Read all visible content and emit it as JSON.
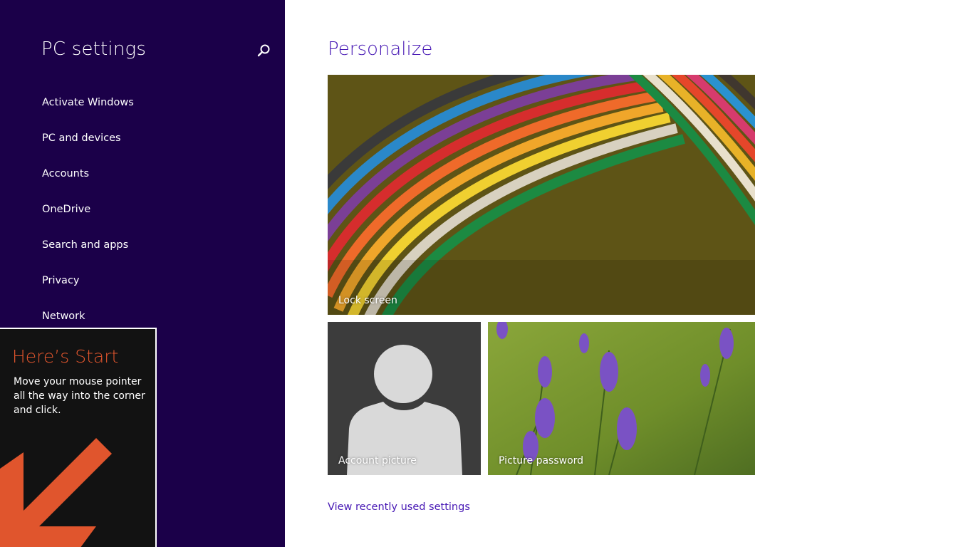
{
  "sidebar": {
    "title": "PC settings",
    "search_icon": "search-icon",
    "items": [
      {
        "label": "Activate Windows"
      },
      {
        "label": "PC and devices"
      },
      {
        "label": "Accounts"
      },
      {
        "label": "OneDrive"
      },
      {
        "label": "Search and apps"
      },
      {
        "label": "Privacy"
      },
      {
        "label": "Network"
      }
    ]
  },
  "tip": {
    "title": "Here’s Start",
    "body": "Move your mouse pointer all the way into the corner and click.",
    "arrow_icon": "arrow-down-left-icon"
  },
  "main": {
    "title": "Personalize",
    "tiles": [
      {
        "label": "Lock screen"
      },
      {
        "label": "Account picture"
      },
      {
        "label": "Picture password"
      }
    ],
    "recent_link": "View recently used settings"
  },
  "colors": {
    "sidebar_bg": "#1b0049",
    "accent": "#4617b4",
    "tip_accent": "#e0552d",
    "tip_bg": "#121212"
  }
}
